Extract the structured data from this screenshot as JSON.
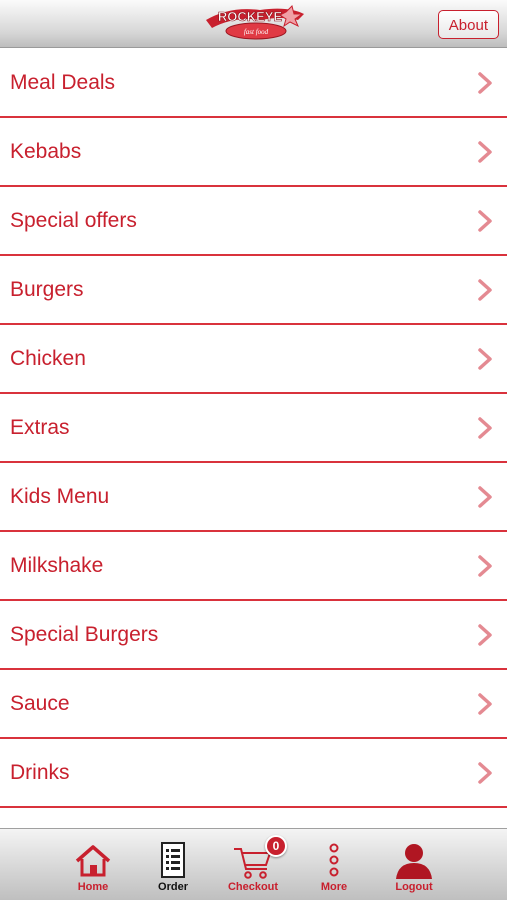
{
  "header": {
    "logo_text": "ROCKEYE",
    "logo_subtext": "fast food",
    "about_label": "About"
  },
  "menu": {
    "items": [
      {
        "label": "Meal Deals"
      },
      {
        "label": "Kebabs"
      },
      {
        "label": "Special offers"
      },
      {
        "label": "Burgers"
      },
      {
        "label": "Chicken"
      },
      {
        "label": "Extras"
      },
      {
        "label": "Kids Menu"
      },
      {
        "label": "Milkshake"
      },
      {
        "label": "Special Burgers"
      },
      {
        "label": "Sauce"
      },
      {
        "label": "Drinks"
      }
    ]
  },
  "tabbar": {
    "home_label": "Home",
    "order_label": "Order",
    "checkout_label": "Checkout",
    "checkout_badge": "0",
    "more_label": "More",
    "logout_label": "Logout"
  },
  "colors": {
    "accent": "#c8202e",
    "divider": "#d9323c"
  }
}
